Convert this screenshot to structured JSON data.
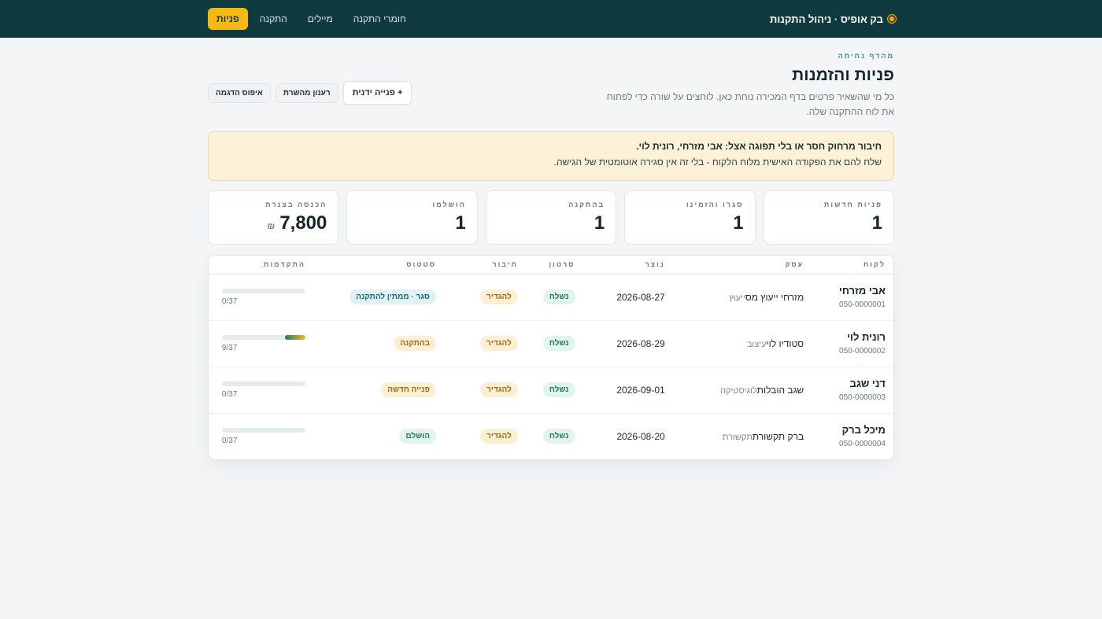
{
  "app": {
    "brand": "בק אופיס · ניהול התקנות",
    "nav": [
      {
        "label": "פניות",
        "active": true
      },
      {
        "label": "התקנה",
        "active": false
      },
      {
        "label": "מיילים",
        "active": false
      },
      {
        "label": "חומרי התקנה",
        "active": false
      }
    ]
  },
  "page": {
    "eyebrow": "מהדף נחיתה",
    "title": "פניות והזמנות",
    "subtitle": "כל מי שהשאיר פרטים בדף המכירה נוחת כאן. לוחצים על שורה כדי לפתוח את לוח ההתקנה שלה.",
    "actions": {
      "manual": "+ פנייה ידנית",
      "refresh": "רענון מהשרת",
      "reset": "איפוס הדגמה"
    }
  },
  "alert": {
    "title": "חיבור מרחוק חסר או בלי תפוגה אצל: אבי מזרחי, רונית לוי.",
    "body": "שלח להם את הפקודה האישית מלוח הלקוח - בלי זה אין סגירה אוטומטית של הגישה."
  },
  "stats": [
    {
      "label": "פניות חדשות",
      "value": "1"
    },
    {
      "label": "סגרו והזמינו",
      "value": "1"
    },
    {
      "label": "בהתקנה",
      "value": "1"
    },
    {
      "label": "הושלמו",
      "value": "1"
    },
    {
      "label": "הכנסה בצנרת",
      "value": "7,800",
      "unit": "₪"
    }
  ],
  "table": {
    "headers": {
      "client": "לקוח",
      "business": "עסק",
      "created": "נוצר",
      "video": "סרטון",
      "connection": "חיבור",
      "status": "סטטוס",
      "progress": "התקדמות"
    },
    "rows": [
      {
        "name": "אבי מזרחי",
        "phone": "050-0000001",
        "business": "מזרחי ייעוץ מס",
        "biz_type": "ייעוץ",
        "created": "2026-08-27",
        "video": "נשלח",
        "connection": "להגדיר",
        "status": "סגר · ממתין להתקנה",
        "status_color": "teal",
        "progress_text": "0/37",
        "progress": 0
      },
      {
        "name": "רונית לוי",
        "phone": "050-0000002",
        "business": "סטודיו לוי",
        "biz_type": "עיצוב",
        "created": "2026-08-29",
        "video": "נשלח",
        "connection": "להגדיר",
        "status": "בהתקנה",
        "status_color": "amber",
        "progress_text": "9/37",
        "progress": 0.243
      },
      {
        "name": "דני שגב",
        "phone": "050-0000003",
        "business": "שגב הובלות",
        "biz_type": "לוגיסטיקה",
        "created": "2026-09-01",
        "video": "נשלח",
        "connection": "להגדיר",
        "status": "פנייה חדשה",
        "status_color": "amber",
        "progress_text": "0/37",
        "progress": 0
      },
      {
        "name": "מיכל ברק",
        "phone": "050-0000004",
        "business": "ברק תקשורת",
        "biz_type": "תקשורת",
        "created": "2026-08-20",
        "video": "נשלח",
        "connection": "להגדיר",
        "status": "הושלם",
        "status_color": "green",
        "progress_text": "0/37",
        "progress": 0
      }
    ]
  }
}
